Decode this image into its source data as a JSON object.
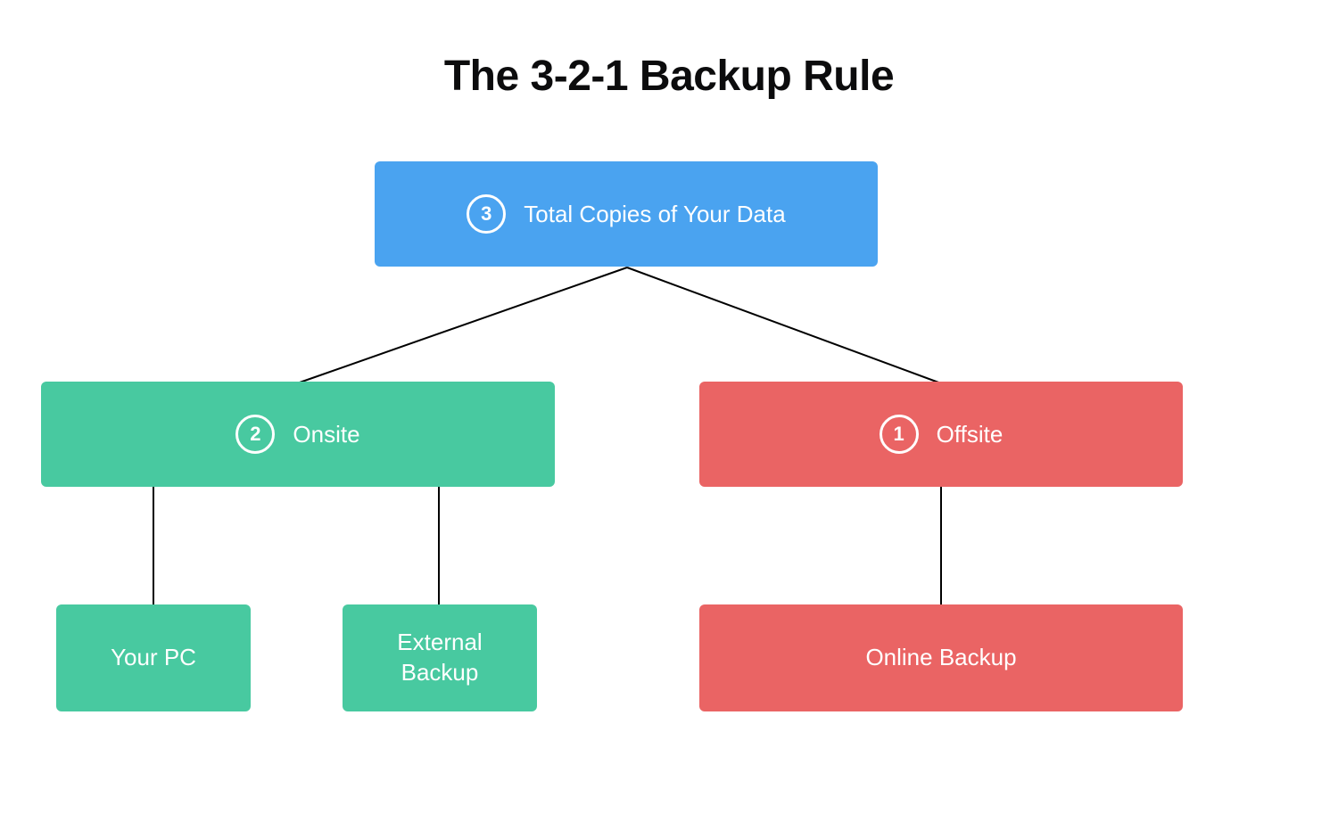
{
  "title": "The 3-2-1 Backup Rule",
  "root": {
    "number": "3",
    "label": "Total Copies of Your Data",
    "color": "#4aa3f0"
  },
  "branches": [
    {
      "number": "2",
      "label": "Onsite",
      "color": "#48c9a0",
      "leaves": [
        {
          "label": "Your PC",
          "color": "#48c9a0"
        },
        {
          "label": "External Backup",
          "color": "#48c9a0"
        }
      ]
    },
    {
      "number": "1",
      "label": "Offsite",
      "color": "#ea6464",
      "leaves": [
        {
          "label": "Online Backup",
          "color": "#ea6464"
        }
      ]
    }
  ]
}
